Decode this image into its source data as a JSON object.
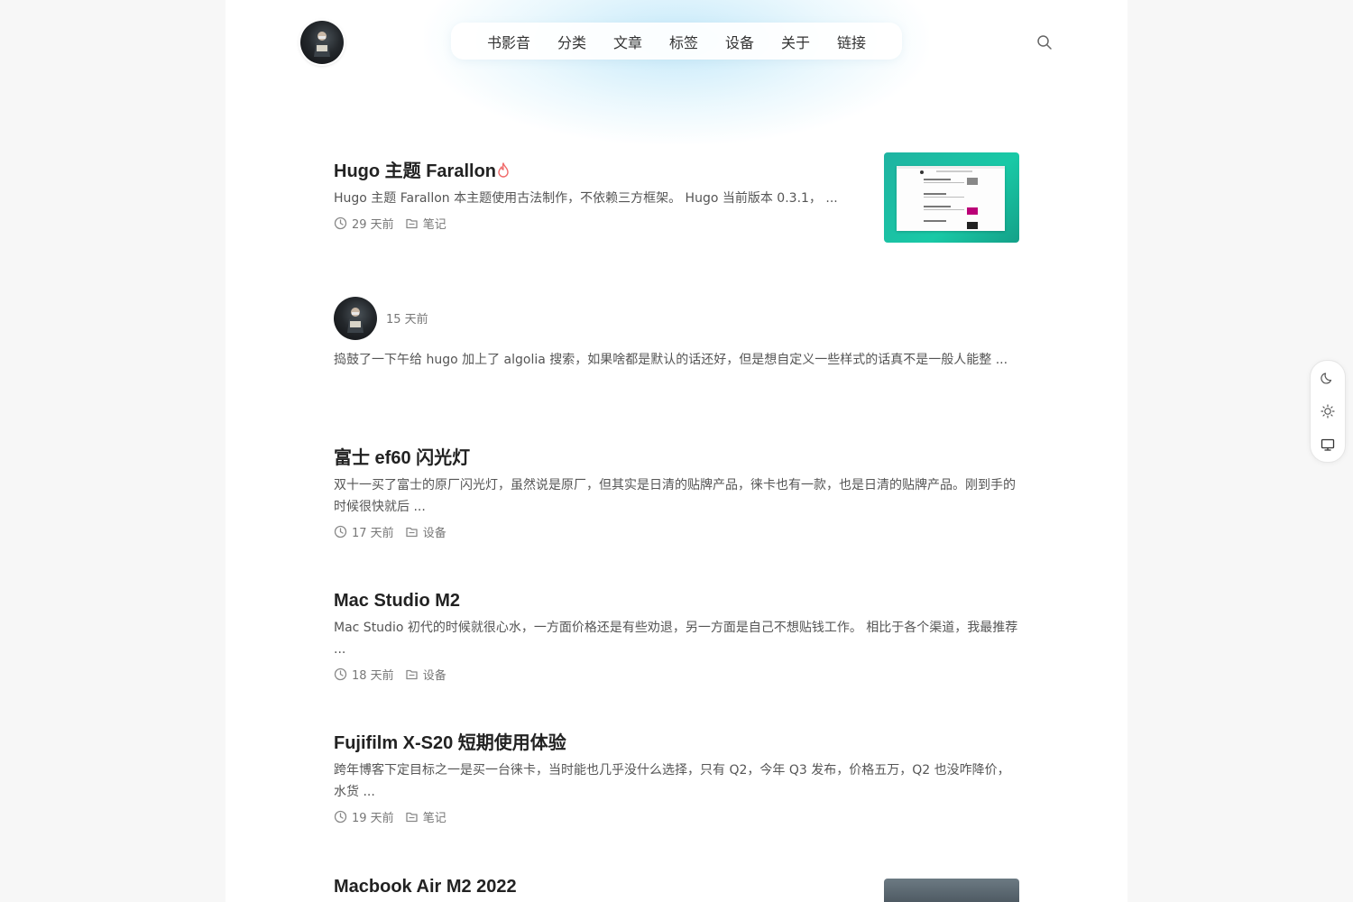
{
  "nav": {
    "items": [
      {
        "label": "书影音"
      },
      {
        "label": "分类"
      },
      {
        "label": "文章"
      },
      {
        "label": "标签"
      },
      {
        "label": "设备"
      },
      {
        "label": "关于"
      },
      {
        "label": "链接"
      }
    ]
  },
  "posts": [
    {
      "title": "Hugo 主题 Farallon",
      "excerpt": "Hugo 主题 Farallon 本主题使用古法制作，不依赖三方框架。 Hugo 当前版本 0.3.1， ...",
      "time": "29 天前",
      "category": "笔记"
    },
    {
      "title": "富士 ef60 闪光灯",
      "excerpt": "双十一买了富士的原厂闪光灯，虽然说是原厂，但其实是日清的贴牌产品，徕卡也有一款，也是日清的贴牌产品。刚到手的时候很快就后 ...",
      "time": "17 天前",
      "category": "设备"
    },
    {
      "title": "Mac Studio M2",
      "excerpt": "Mac Studio 初代的时候就很心水，一方面价格还是有些劝退，另一方面是自己不想贴钱工作。 相比于各个渠道，我最推荐 ...",
      "time": "18 天前",
      "category": "设备"
    },
    {
      "title": "Fujifilm X-S20 短期使用体验",
      "excerpt": "跨年博客下定目标之一是买一台徕卡，当时能也几乎没什么选择，只有 Q2，今年 Q3 发布，价格五万，Q2 也没咋降价，水货 ...",
      "time": "19 天前",
      "category": "笔记"
    },
    {
      "title": "Macbook Air M2 2022"
    }
  ],
  "memo": {
    "time": "15 天前",
    "text": "捣鼓了一下午给 hugo 加上了 algolia 搜索，如果啥都是默认的话还好，但是想自定义一些样式的话真不是一般人能整 ..."
  },
  "colors": {
    "hot_icon": "#f06a6a",
    "thumb_accent": "#19c9a6"
  },
  "icons": [
    "search-icon",
    "clock-icon",
    "folder-icon",
    "fire-icon",
    "moon-icon",
    "sun-icon",
    "monitor-icon"
  ]
}
